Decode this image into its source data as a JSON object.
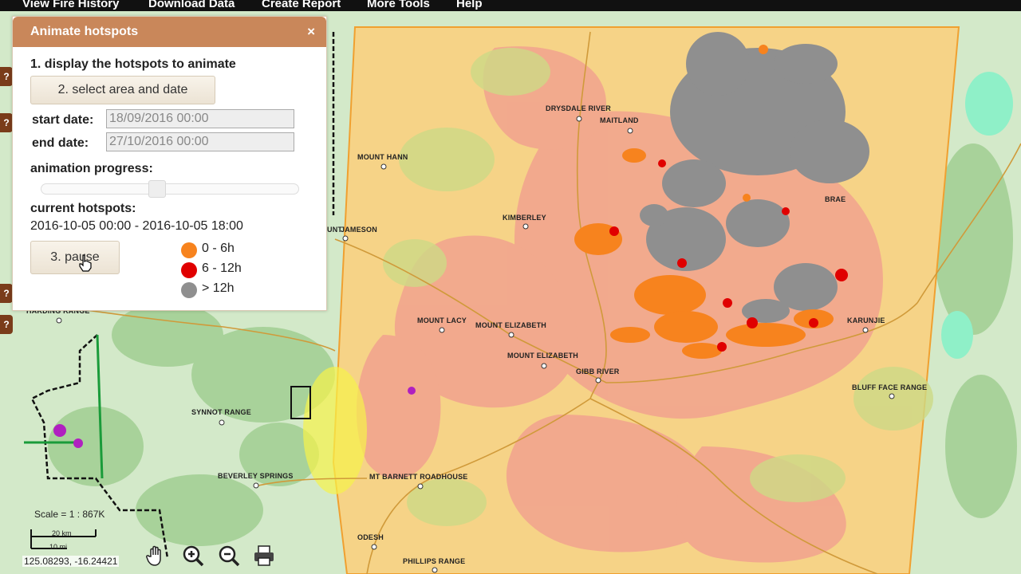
{
  "nav": {
    "items": [
      "View Fire History",
      "Download Data",
      "Create Report",
      "More Tools",
      "Help"
    ]
  },
  "panel": {
    "title": "Animate hotspots",
    "close": "×",
    "step1_label": "1. display the hotspots to animate",
    "step2_button": "2. select area and date",
    "start_label": "start date:",
    "start_value": "18/09/2016 00:00",
    "end_label": "end date:",
    "end_value": "27/10/2016 00:00",
    "progress_label": "animation progress:",
    "progress_fraction": 0.45,
    "current_label": "current hotspots:",
    "current_range": "2016-10-05 00:00 - 2016-10-05 18:00",
    "pause_button": "3. pause",
    "legend": [
      {
        "label": "0 - 6h",
        "color": "#f7831e"
      },
      {
        "label": "6 - 12h",
        "color": "#e00000"
      },
      {
        "label": "> 12h",
        "color": "#8f8f8f"
      }
    ]
  },
  "side_help": [
    "?",
    "?",
    "?",
    "?"
  ],
  "places": [
    "DRYSDALE RIVER",
    "MAITLAND",
    "MOUNT HANN",
    "KIMBERLEY",
    "JAMESON",
    "UNT",
    "MOUNT LACY",
    "MOUNT ELIZABETH",
    "MOUNT ELIZABETH",
    "GIBB RIVER",
    "KARUNJIE",
    "BLUFF FACE RANGE",
    "SYNNOT RANGE",
    "BEVERLEY SPRINGS",
    "MT BARNETT ROADHOUSE",
    "ODESH",
    "PHILLIPS RANGE",
    "HARDING RANGE",
    "BRAE"
  ],
  "scale": {
    "text": "Scale = 1 : 867K",
    "bar_km": "20 km",
    "bar_mi": "10 mi"
  },
  "coordinates": "125.08293, -16.24421",
  "tools": [
    "pan-hand",
    "zoom-in",
    "zoom-out",
    "print"
  ],
  "colors": {
    "header": "#c9875a",
    "hotspot_recent": "#f7831e",
    "hotspot_mid": "#e00000",
    "hotspot_old": "#8f8f8f"
  }
}
